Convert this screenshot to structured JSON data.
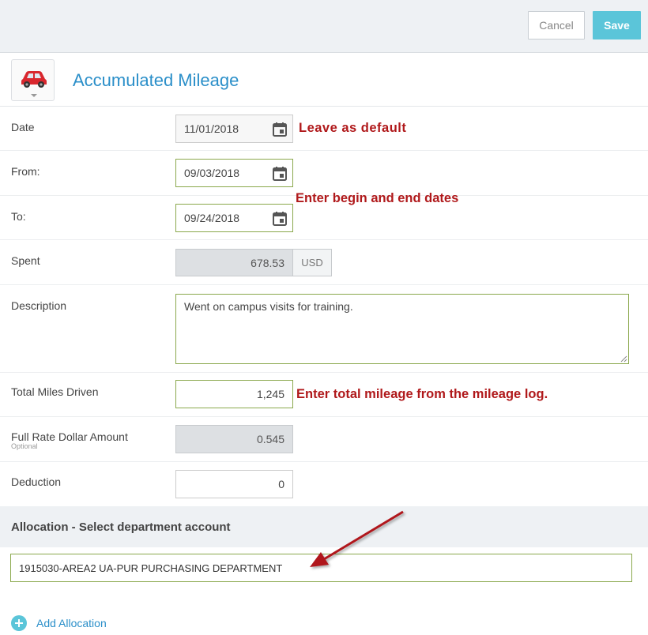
{
  "toolbar": {
    "cancel_label": "Cancel",
    "save_label": "Save"
  },
  "header": {
    "title": "Accumulated Mileage",
    "icon": "car-icon"
  },
  "form": {
    "date": {
      "label": "Date",
      "value": "11/01/2018"
    },
    "from": {
      "label": "From:",
      "value": "09/03/2018"
    },
    "to": {
      "label": "To:",
      "value": "09/24/2018"
    },
    "spent": {
      "label": "Spent",
      "value": "678.53",
      "currency": "USD"
    },
    "description": {
      "label": "Description",
      "value": "Went on campus visits for training."
    },
    "total_miles": {
      "label": "Total Miles Driven",
      "value": "1,245"
    },
    "full_rate": {
      "label": "Full Rate Dollar Amount",
      "sublabel": "Optional",
      "value": "0.545"
    },
    "deduction": {
      "label": "Deduction",
      "value": "0"
    }
  },
  "annotations": {
    "date_note": "Leave as default",
    "dates_note": "Enter begin and end dates",
    "miles_note": "Enter total mileage from the mileage log."
  },
  "allocation": {
    "heading": "Allocation - Select department account",
    "account": "1915030-AREA2 UA-PUR PURCHASING DEPARTMENT",
    "add_label": "Add Allocation"
  },
  "colors": {
    "accent": "#2b8fc9",
    "save": "#5bc5d9",
    "annotation": "#b0191b",
    "valid_border": "#8aa84c"
  }
}
